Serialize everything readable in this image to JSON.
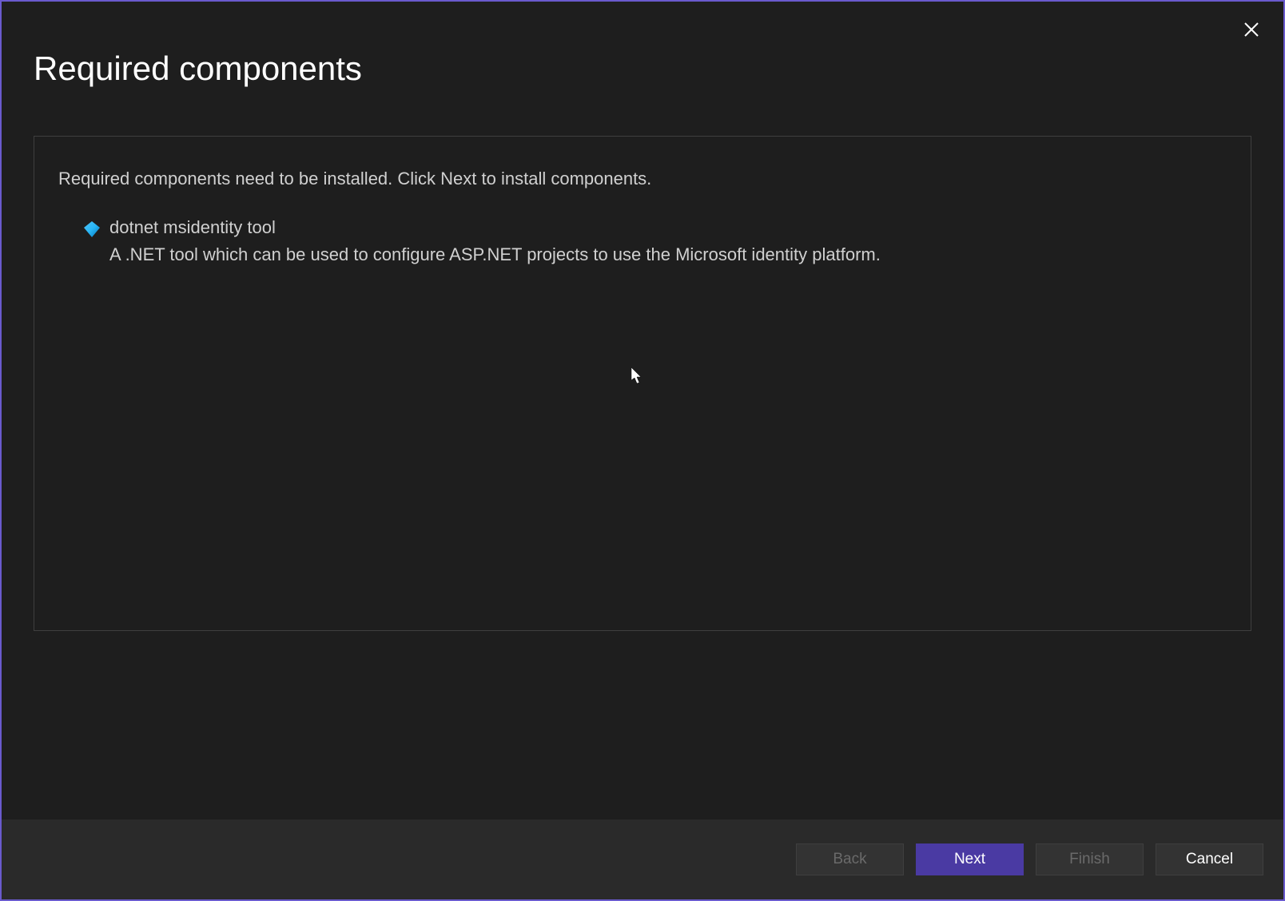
{
  "dialog": {
    "title": "Required components",
    "instruction": "Required components need to be installed. Click Next to install components."
  },
  "components": [
    {
      "name": "dotnet msidentity tool",
      "description": "A .NET tool which can be used to configure ASP.NET projects to use the Microsoft identity platform."
    }
  ],
  "buttons": {
    "back": "Back",
    "next": "Next",
    "finish": "Finish",
    "cancel": "Cancel"
  }
}
